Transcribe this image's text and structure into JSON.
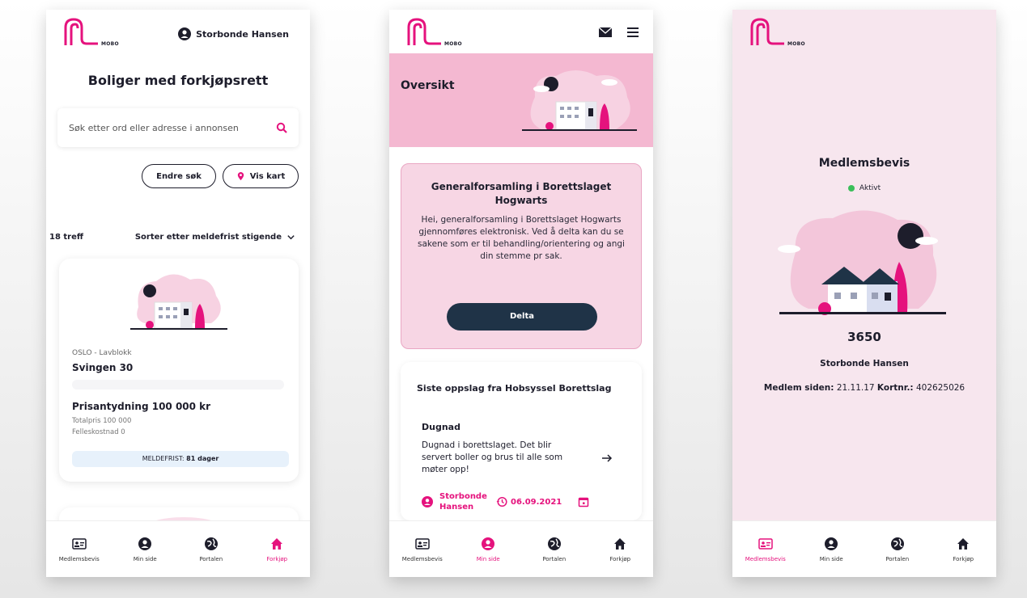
{
  "brand": {
    "logo_word": "MOBO",
    "accent": "#e5127d",
    "pink_light": "#f4b8d1",
    "navy": "#1f3347"
  },
  "nav": {
    "items": [
      {
        "label": "Medlemsbevis",
        "icon": "id-card-icon"
      },
      {
        "label": "Min side",
        "icon": "user-icon"
      },
      {
        "label": "Portalen",
        "icon": "globe-icon"
      },
      {
        "label": "Forkjøp",
        "icon": "home-icon"
      }
    ]
  },
  "screen1": {
    "user": "Storbonde Hansen",
    "title": "Boliger med forkjøpsrett",
    "search_placeholder": "Søk etter ord eller adresse i annonsen",
    "edit_search": "Endre søk",
    "show_map": "Vis kart",
    "hits": "18 treff",
    "sort": "Sorter etter meldefrist stigende",
    "listing": {
      "location": "OSLO - Lavblokk",
      "address": "Svingen 30",
      "price": "Prisantydning 100 000 kr",
      "total": "Totalpris 100 000",
      "shared_cost": "Felleskostnad 0",
      "deadline_label": "MELDEFRIST:",
      "deadline_value": "81 dager"
    }
  },
  "screen2": {
    "hero_title": "Oversikt",
    "meeting": {
      "title": "Generalforsamling i Borettslaget Hogwarts",
      "body": "Hei, generalforsamling i Borettslaget Hogwarts gjennomføres elektronisk. Ved å delta kan du se sakene som er til behandling/orientering og angi din stemme pr sak.",
      "button": "Delta"
    },
    "posts": {
      "heading": "Siste oppslag fra Hobsyssel Borettslag",
      "title": "Dugnad",
      "body": "Dugnad i borettslaget. Det blir servert boller og brus til alle som møter opp!",
      "author": "Storbonde Hansen",
      "date": "06.09.2021"
    }
  },
  "screen3": {
    "title": "Medlemsbevis",
    "status": "Aktivt",
    "number": "3650",
    "name": "Storbonde Hansen",
    "member_since_label": "Medlem siden:",
    "member_since": "21.11.17",
    "card_no_label": "Kortnr.:",
    "card_no": "402625026"
  }
}
